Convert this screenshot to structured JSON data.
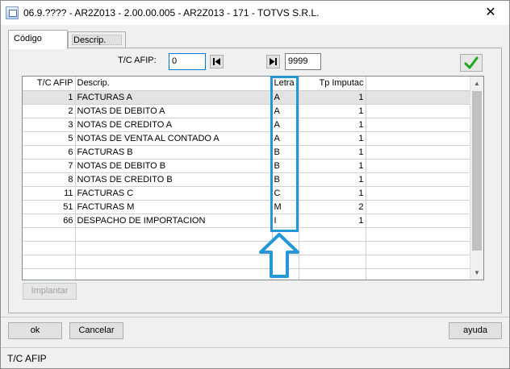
{
  "window": {
    "title": "06.9.???? - AR2Z013 - 2.00.00.005 - AR2Z013 - 171 - TOTVS S.R.L.",
    "close_glyph": "✕"
  },
  "tabs": [
    {
      "label": "Código",
      "active": true
    },
    {
      "label": "Descrip.",
      "active": false
    }
  ],
  "filter": {
    "label": "T/C AFIP:",
    "from_value": "0",
    "to_value": "9999"
  },
  "grid": {
    "columns": [
      "T/C AFIP",
      "Descrip.",
      "Letra",
      "Tp Imputac"
    ],
    "rows": [
      {
        "code": "1",
        "descrip": "FACTURAS A",
        "letra": "A",
        "tp": "1"
      },
      {
        "code": "2",
        "descrip": "NOTAS DE DEBITO A",
        "letra": "A",
        "tp": "1"
      },
      {
        "code": "3",
        "descrip": "NOTAS DE CREDITO A",
        "letra": "A",
        "tp": "1"
      },
      {
        "code": "5",
        "descrip": "NOTAS DE VENTA AL CONTADO A",
        "letra": "A",
        "tp": "1"
      },
      {
        "code": "6",
        "descrip": "FACTURAS B",
        "letra": "B",
        "tp": "1"
      },
      {
        "code": "7",
        "descrip": "NOTAS DE DEBITO B",
        "letra": "B",
        "tp": "1"
      },
      {
        "code": "8",
        "descrip": "NOTAS DE CREDITO B",
        "letra": "B",
        "tp": "1"
      },
      {
        "code": "11",
        "descrip": "FACTURAS C",
        "letra": "C",
        "tp": "1"
      },
      {
        "code": "51",
        "descrip": "FACTURAS M",
        "letra": "M",
        "tp": "2"
      },
      {
        "code": "66",
        "descrip": "DESPACHO DE IMPORTACION",
        "letra": "I",
        "tp": "1"
      }
    ],
    "selected_row": 0,
    "empty_rows": 4
  },
  "buttons": {
    "implantar": "Implantar",
    "ok": "ok",
    "cancelar": "Cancelar",
    "ayuda": "ayuda"
  },
  "status": {
    "text": "T/C AFIP"
  },
  "colors": {
    "highlight": "#2596d8",
    "check": "#1aa81a"
  }
}
